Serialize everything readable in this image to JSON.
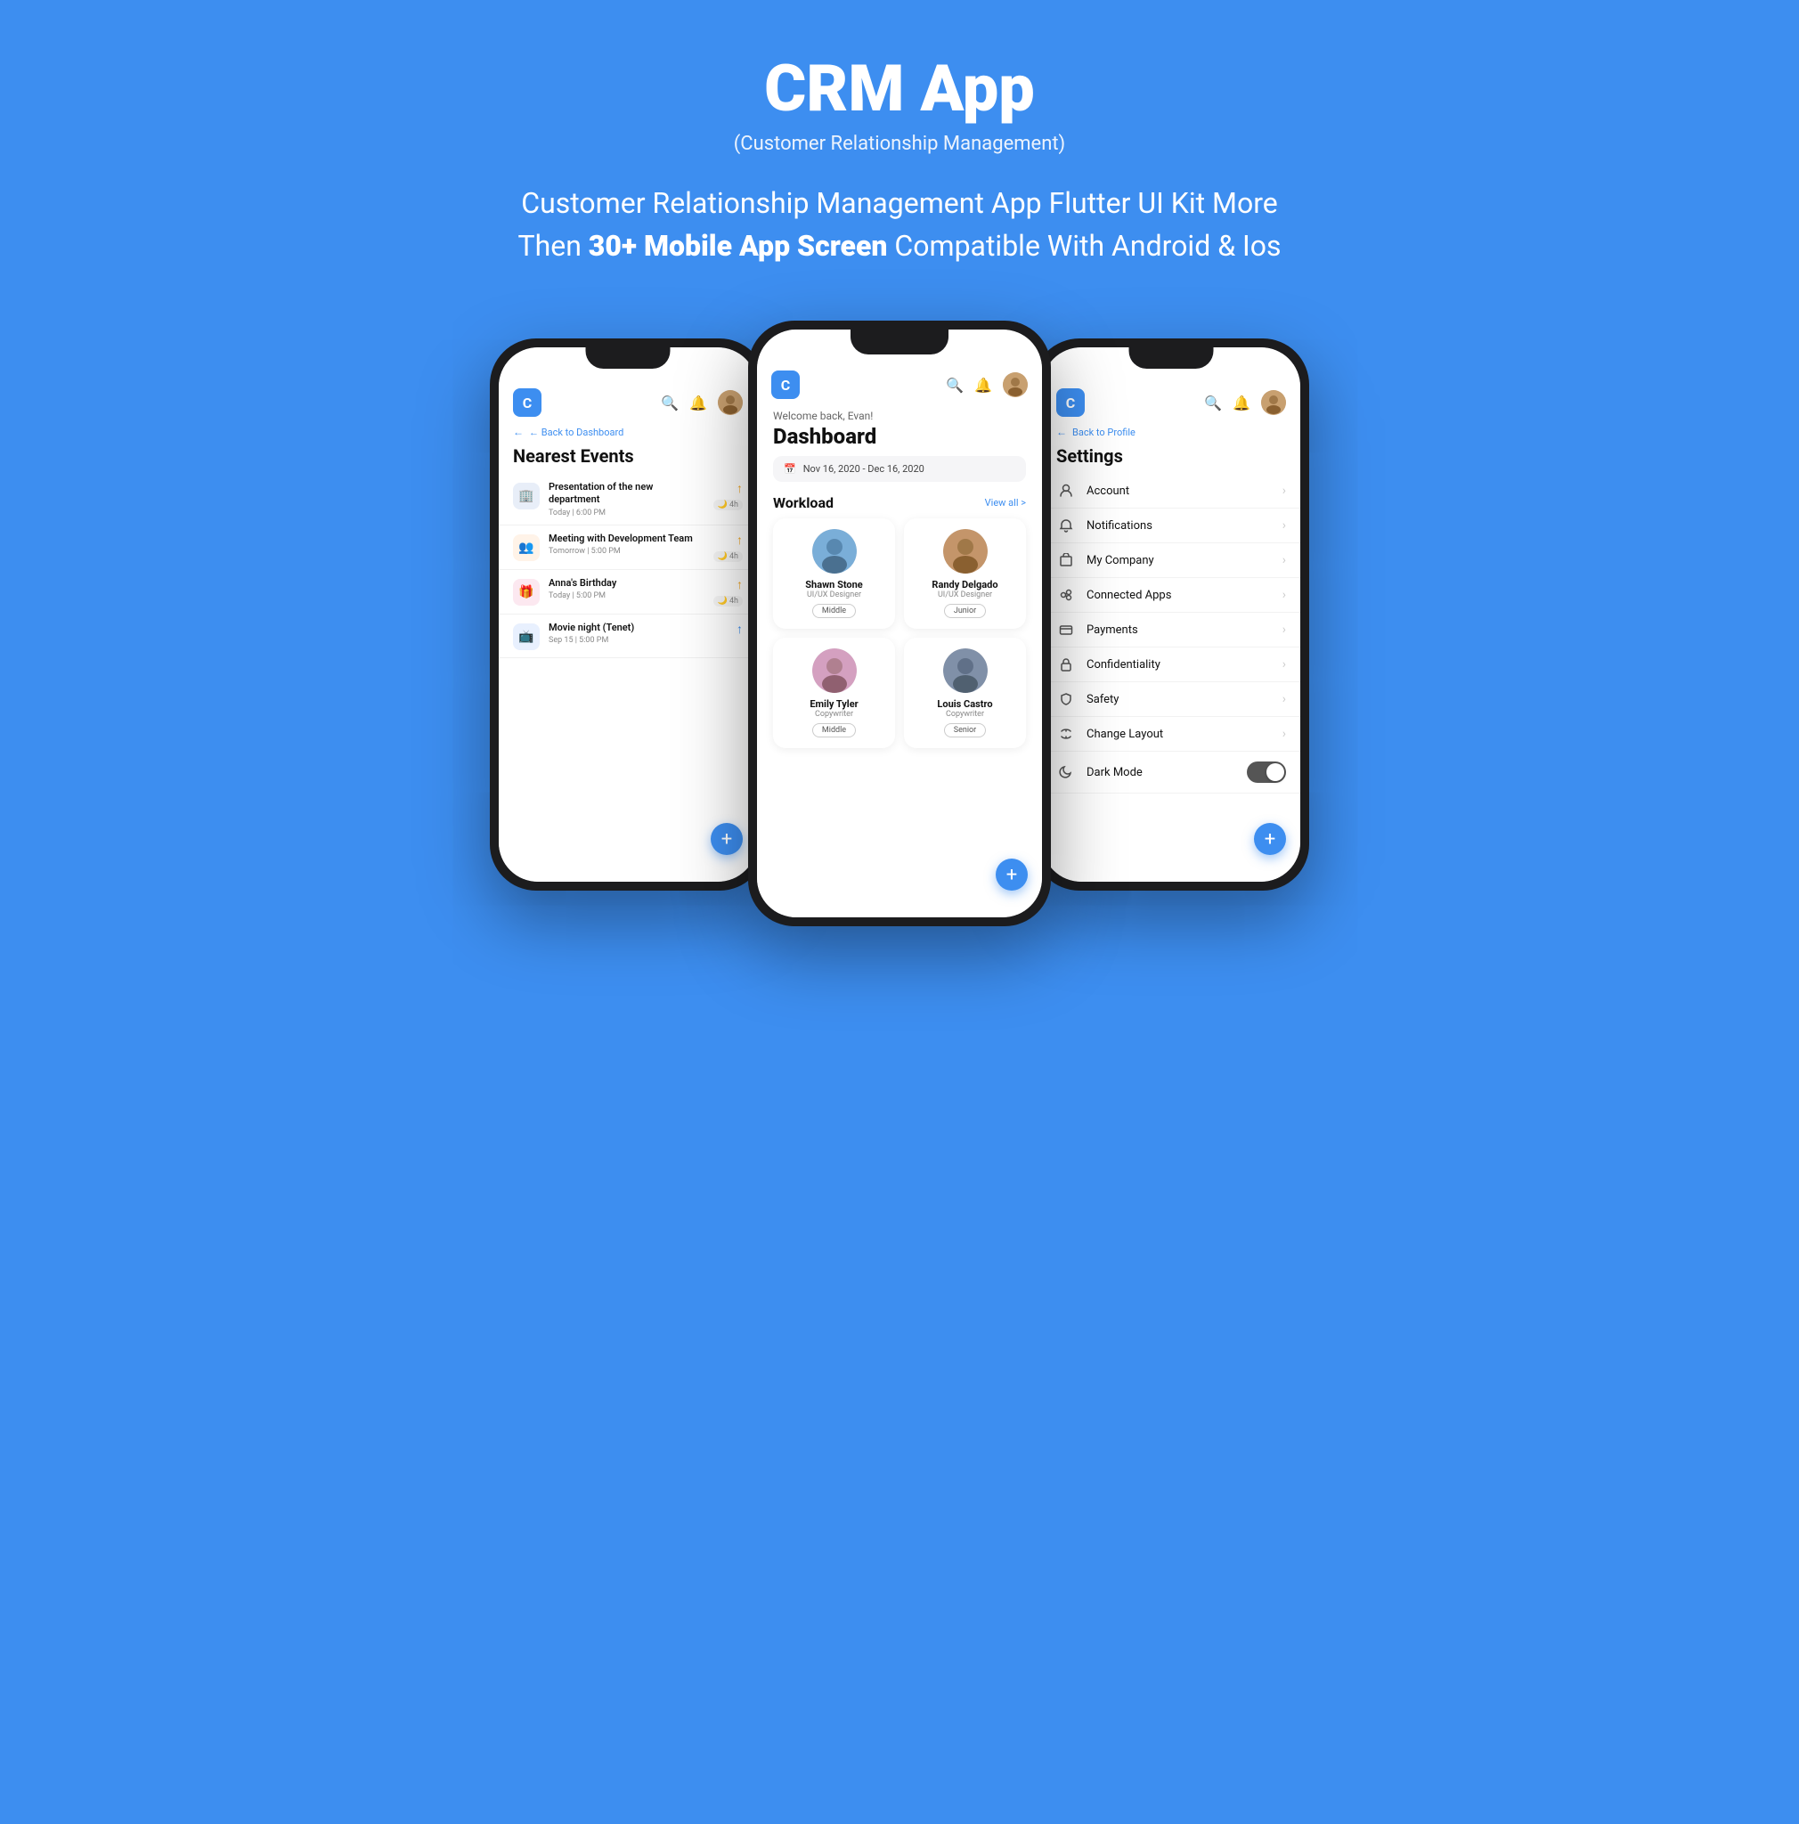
{
  "header": {
    "title": "CRM App",
    "subtitle": "(Customer Relationship Management)",
    "description_part1": "Customer Relationship Management App Flutter UI Kit More Then ",
    "description_bold": "30+ Mobile App Screen",
    "description_part2": " Compatible With Android & Ios"
  },
  "phone_left": {
    "logo": "C",
    "back_label": "← Back to Dashboard",
    "screen_title": "Nearest Events",
    "events": [
      {
        "icon": "🏢",
        "title": "Presentation of the new department",
        "time": "Today | 6:00 PM",
        "duration": "4h",
        "highlight": true
      },
      {
        "icon": "👥",
        "title": "Meeting with Development Team",
        "time": "Tomorrow | 5:00 PM",
        "duration": "4h",
        "highlight": false
      },
      {
        "icon": "🎁",
        "title": "Anna's Birthday",
        "time": "Today | 5:00 PM",
        "duration": "4h",
        "highlight": false
      },
      {
        "icon": "📺",
        "title": "Movie night (Tenet)",
        "time": "Sep 15 | 5:00 PM",
        "duration": "",
        "highlight": false
      }
    ],
    "fab_label": "+"
  },
  "phone_center": {
    "logo": "C",
    "welcome": "Welcome back, Evan!",
    "title": "Dashboard",
    "date_range": "Nov 16, 2020 - Dec 16, 2020",
    "workload_label": "Workload",
    "view_all": "View all >",
    "workers": [
      {
        "name": "Shawn Stone",
        "role": "UI/UX Designer",
        "level": "Middle",
        "avatar_color": "#7aaec8"
      },
      {
        "name": "Randy Delgado",
        "role": "UI/UX Designer",
        "level": "Junior",
        "avatar_color": "#b8824a"
      },
      {
        "name": "Emily Tyler",
        "role": "Copywriter",
        "level": "Middle",
        "avatar_color": "#c090a8"
      },
      {
        "name": "Louis Castro",
        "role": "Copywriter",
        "level": "Senior",
        "avatar_color": "#7890a0"
      }
    ],
    "fab_label": "+"
  },
  "phone_right": {
    "logo": "C",
    "back_label": "← Back to Profile",
    "screen_title": "Settings",
    "settings_items": [
      {
        "icon": "person",
        "label": "Account",
        "type": "nav"
      },
      {
        "icon": "bell",
        "label": "Notifications",
        "type": "nav"
      },
      {
        "icon": "building",
        "label": "My Company",
        "type": "nav"
      },
      {
        "icon": "apps",
        "label": "Connected Apps",
        "type": "nav"
      },
      {
        "icon": "card",
        "label": "Payments",
        "type": "nav"
      },
      {
        "icon": "lock",
        "label": "Confidentiality",
        "type": "nav"
      },
      {
        "icon": "shield",
        "label": "Safety",
        "type": "nav"
      },
      {
        "icon": "layout",
        "label": "Change Layout",
        "type": "nav"
      },
      {
        "icon": "moon",
        "label": "Dark Mode",
        "type": "toggle"
      }
    ],
    "fab_label": "+"
  },
  "colors": {
    "brand_blue": "#3d8ef0",
    "background": "#3d8ef0",
    "white": "#ffffff",
    "text_dark": "#111111",
    "text_light": "#888888"
  }
}
